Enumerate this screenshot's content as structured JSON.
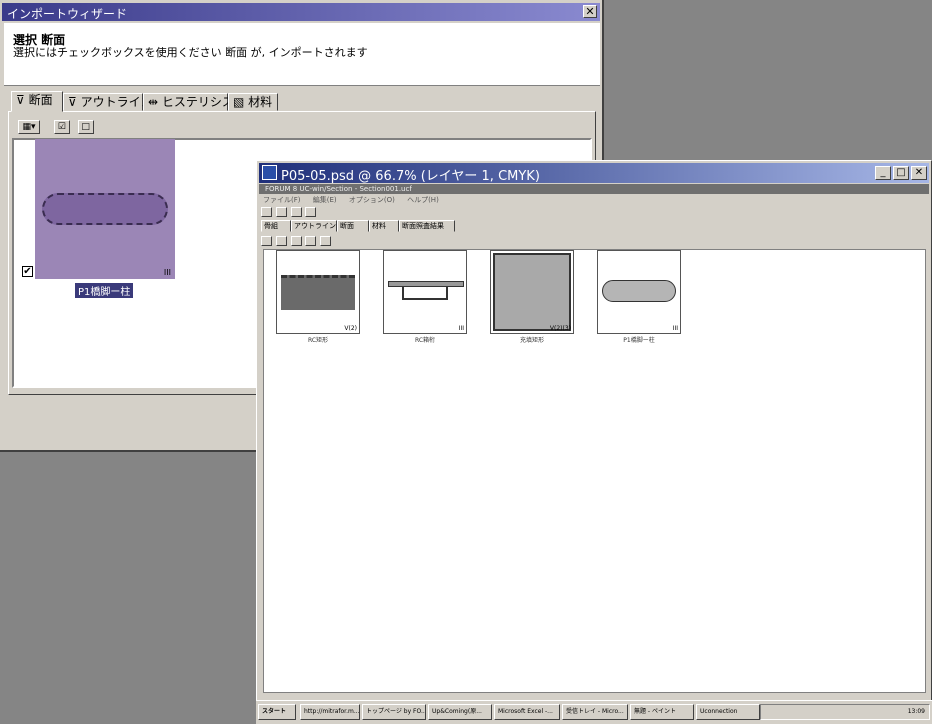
{
  "wizard": {
    "title": "インポートウィザード",
    "close": "✕",
    "heading": "選択 断面",
    "subtitle": "選択にはチェックボックスを使用ください 断面 が, インポートされます",
    "tabs": [
      {
        "label": "断面",
        "icon": "section-icon"
      },
      {
        "label": "アウトライン",
        "icon": "outline-icon"
      },
      {
        "label": "ヒステリシス",
        "icon": "hysteresis-icon"
      },
      {
        "label": "材料",
        "icon": "material-icon"
      }
    ],
    "toolbar": {
      "view_icon": "grid-view-icon",
      "check_all": "☑",
      "uncheck_all": "□"
    },
    "item": {
      "caption": "P1橋脚ー柱",
      "checked": "✔",
      "badge": "III"
    }
  },
  "photoshop": {
    "title": "P05-05.psd @ 66.7% (レイヤー 1, CMYK)",
    "buttons": {
      "minimize": "_",
      "maximize": "□",
      "close": "✕"
    },
    "inner_title": "FORUM 8 UC-win/Section - Section001.ucf",
    "inner_menu": [
      "ファイル(F)",
      "編集(E)",
      "オプション(O)",
      "ヘルプ(H)"
    ],
    "inner_tabs": [
      "骨組",
      "アウトライン",
      "断面",
      "材料",
      "断面照査結果"
    ],
    "thumbnails": [
      {
        "caption": "RC矩形",
        "badge": "V(2)"
      },
      {
        "caption": "RC箱桁",
        "badge": "III"
      },
      {
        "caption": "充填矩形",
        "badge": "V(2)(3)"
      },
      {
        "caption": "P1橋脚ー柱",
        "badge": "III"
      }
    ]
  },
  "taskbar": {
    "start": "スタート",
    "items": [
      "http://mitrafor.m...",
      "トップページ by FO...",
      "Up&Coming(原...",
      "Microsoft Excel -...",
      "受信トレイ - Micro...",
      "無題 - ペイント",
      "Uconnection"
    ],
    "clock": "13:09"
  }
}
